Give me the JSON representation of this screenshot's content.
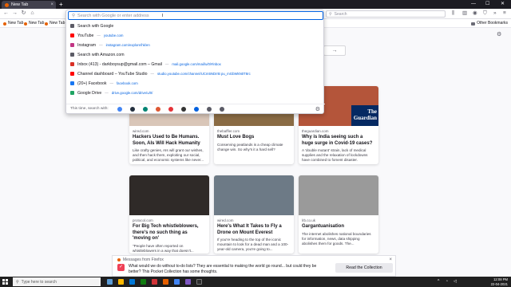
{
  "browser": {
    "tab_title": "New Tab",
    "nav_search_placeholder": "Search",
    "url_placeholder": "Search with Google or enter address"
  },
  "bookmarks": {
    "items": [
      {
        "label": "New Tab"
      },
      {
        "label": "New Tab"
      },
      {
        "label": "New Tab"
      }
    ],
    "other_label": "Other Bookmarks"
  },
  "suggestions": [
    {
      "title": "Search with Google",
      "url": "",
      "icon": "search-icon",
      "color": "#5b5b66"
    },
    {
      "title": "YouTube",
      "url": "youtube.com",
      "icon": "youtube-icon",
      "color": "#ff0000"
    },
    {
      "title": "Instagram",
      "url": "instagram.com/explore/hk/en",
      "icon": "instagram-icon",
      "color": "#c13584"
    },
    {
      "title": "Search with Amazon.com",
      "url": "",
      "icon": "search-icon",
      "color": "#5b5b66"
    },
    {
      "title": "Inbox (413) - darkboysup@gmail.com – Gmail",
      "url": "mail.google.com/mail/u/0/#inbox",
      "icon": "gmail-icon",
      "color": "#d93025"
    },
    {
      "title": "Channel dashboard – YouTube Studio",
      "url": "studio.youtube.com/channel/UCm5NDrrB pu_mGbWkN0T8rc",
      "icon": "youtube-icon",
      "color": "#ff0000"
    },
    {
      "title": "(20+) Facebook",
      "url": "facebook.com",
      "icon": "facebook-icon",
      "color": "#1877f2"
    },
    {
      "title": "Google Drive",
      "url": "drive.google.com/drive/u/0/",
      "icon": "drive-icon",
      "color": "#1fa463"
    }
  ],
  "engines": {
    "label": "This time, search with:",
    "items": [
      {
        "name": "google-engine-icon",
        "color": "#4285f4"
      },
      {
        "name": "amazon-engine-icon",
        "color": "#232f3e"
      },
      {
        "name": "bing-engine-icon",
        "color": "#008373"
      },
      {
        "name": "duckduckgo-engine-icon",
        "color": "#de5833"
      },
      {
        "name": "ebay-engine-icon",
        "color": "#e53238"
      },
      {
        "name": "wikipedia-engine-icon",
        "color": "#333333"
      },
      {
        "name": "bookmarks-engine-icon",
        "color": "#0060df"
      },
      {
        "name": "tabs-engine-icon",
        "color": "#5b5b66"
      },
      {
        "name": "history-engine-icon",
        "color": "#5b5b66"
      }
    ]
  },
  "cards": [
    {
      "source": "wired.com",
      "title": "Hackers Used to Be Humans. Soon, AIs Will Hack Humanity",
      "desc": "Like crafty genies, AIs will grant our wishes, and then hack them, exploiting our social, political, and economic systems like never...",
      "thumb": "#d9c6b8"
    },
    {
      "source": "thebaffler.com",
      "title": "Must Love Bogs",
      "desc": "Conserving peatlands is a cheap climate change win. So why's it a hard sell?",
      "thumb": "#8a6b44"
    },
    {
      "source": "theguardian.com",
      "title": "Why is India seeing such a huge surge in Covid-19 cases?",
      "desc": "A 'double mutant' strain, lack of medical supplies and the relaxation of lockdowns have combined to foment disaster.",
      "thumb": "#b4553a"
    },
    {
      "source": "protocol.com",
      "title": "For Big Tech whistleblowers, there's no such thing as 'moving on'",
      "desc": "\"People have often reported on whistleblowers in a way that doesn't...",
      "thumb": "#2f2a28"
    },
    {
      "source": "wired.com",
      "title": "Here's What It Takes to Fly a Drone on Mount Everest",
      "desc": "If you're heading to the top of the iconic mountain to look for a dead man and a 100-year-old camera, you're going to...",
      "thumb": "#6d7a86"
    },
    {
      "source": "lrb.co.uk",
      "title": "Gargantuanisation",
      "desc": "The internet abolishes national boundaries for information, news, data shipping abolishes them for goods. The...",
      "thumb": "#9a9a9a"
    }
  ],
  "guardian_logo": "The Guardian",
  "notification": {
    "header": "Messages from Firefox",
    "message": "What would we do without to-do lists? They are essential to making the world go round... but could they be better? This Pocket Collection has some thoughts.",
    "button": "Read the Collection"
  },
  "taskbar": {
    "search_placeholder": "Type here to search",
    "time": "12:08 PM",
    "date": "22-04-2021"
  }
}
